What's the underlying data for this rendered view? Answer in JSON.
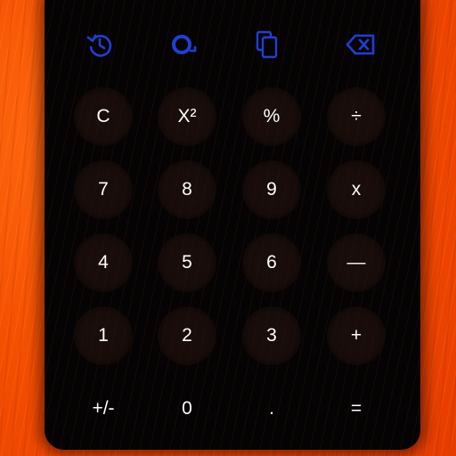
{
  "toolbar": {
    "icons": [
      "history-icon",
      "unit-converter-icon",
      "copy-icon",
      "backspace-icon"
    ],
    "accent_color": "#1f3fd6"
  },
  "keypad": {
    "rows": [
      [
        "C",
        "X²",
        "%",
        "÷"
      ],
      [
        "7",
        "8",
        "9",
        "x"
      ],
      [
        "4",
        "5",
        "6",
        "—"
      ],
      [
        "1",
        "2",
        "3",
        "+"
      ],
      [
        "+/-",
        "0",
        ".",
        "="
      ]
    ]
  },
  "colors": {
    "background": "#f54f00",
    "panel": "#050303",
    "key_text": "#ffffff"
  }
}
